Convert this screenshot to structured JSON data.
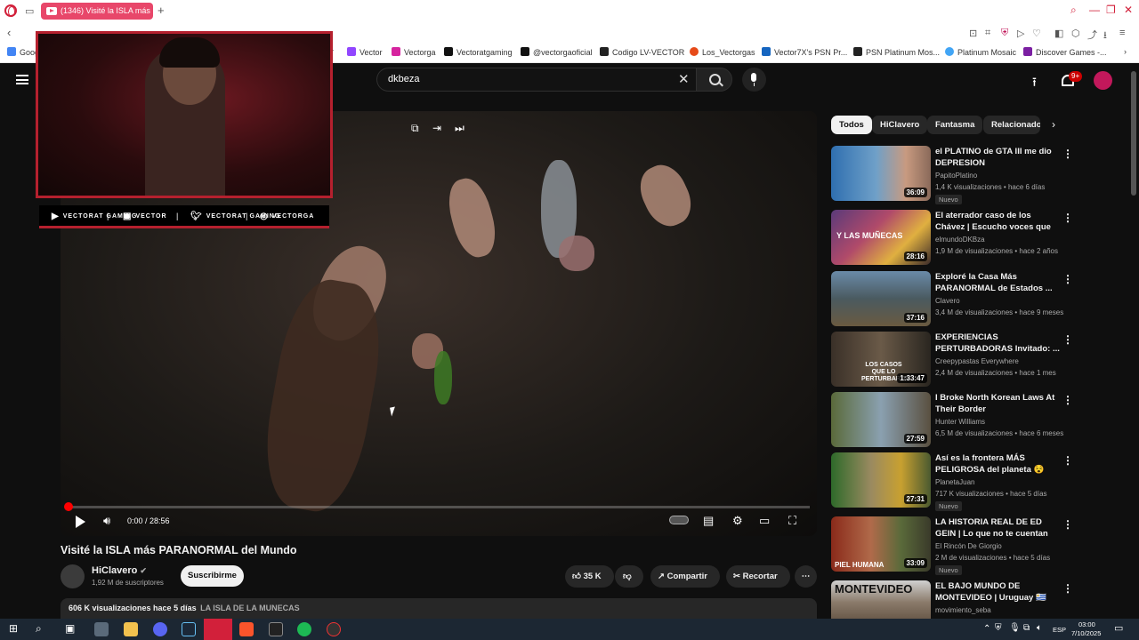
{
  "browser": {
    "tab_title": "(1346) Visité la ISLA más",
    "bookmarks": [
      {
        "label": "Google"
      },
      {
        "label": "r"
      },
      {
        "label": "Vector"
      },
      {
        "label": "Vectorga"
      },
      {
        "label": "Vectoratgaming"
      },
      {
        "label": "@vectorgaoficial"
      },
      {
        "label": "Codigo LV-VECTOR"
      },
      {
        "label": "Los_Vectorgas"
      },
      {
        "label": "Vector7X's PSN Pr..."
      },
      {
        "label": "PSN Platinum Mos..."
      },
      {
        "label": "Platinum Mosaic"
      },
      {
        "label": "Discover Games -..."
      }
    ]
  },
  "header": {
    "search_value": "dkbeza",
    "notif_count": "9+"
  },
  "player": {
    "time": "0:00 / 28:56",
    "progress": 0.0
  },
  "overlay": {
    "social": [
      "GAMING",
      "VECTOR",
      "GAMING",
      "VECTORGA"
    ],
    "social_prefix": [
      "VECTORAT",
      "",
      "VECTORAT",
      ""
    ]
  },
  "video": {
    "title": "Visité la ISLA más PARANORMAL del Mundo",
    "channel": "HiClavero",
    "subscribers": "1,92 M de suscriptores",
    "subscribe_label": "Suscribirme",
    "likes": "35 K",
    "share_label": "Compartir",
    "clip_label": "Recortar",
    "views_date": "606 K visualizaciones  hace 5 días",
    "tag": "LA ISLA DE LA MUNECAS"
  },
  "sidebar": {
    "chips": [
      "Todos",
      "HiClavero",
      "Fantasma",
      "Relacionado"
    ],
    "items": [
      {
        "title": "el PLATINO de GTA III me dio DEPRESION",
        "channel": "PapitoPlatino",
        "meta": "1,4 K visualizaciones • hace 6 días",
        "duration": "36:09",
        "badge": "Nuevo"
      },
      {
        "title": "El aterrador caso de los Chávez | Escucho voces que vienen de...",
        "channel": "elmundoDKBza",
        "meta": "1,9 M de visualizaciones • hace 2 años",
        "duration": "28:16",
        "badge": ""
      },
      {
        "title": "Exploré la Casa Más PARANORMAL de Estados ...",
        "channel": "Clavero",
        "meta": "3,4 M de visualizaciones • hace 9 meses",
        "duration": "37:16",
        "badge": ""
      },
      {
        "title": "EXPERIENCIAS PERTURBADORAS Invitado: ...",
        "channel": "Creepypastas Everywhere",
        "meta": "2,4 M de visualizaciones • hace 1 mes",
        "duration": "1:33:47",
        "badge": ""
      },
      {
        "title": "I Broke North Korean Laws At Their Border",
        "channel": "Hunter Williams",
        "meta": "6,5 M de visualizaciones • hace 6 meses",
        "duration": "27:59",
        "badge": ""
      },
      {
        "title": "Así es la frontera MÁS PELIGROSA del planeta 😵",
        "channel": "PlanetaJuan",
        "meta": "717 K visualizaciones • hace 5 días",
        "duration": "27:31",
        "badge": "Nuevo"
      },
      {
        "title": "LA HISTORIA REAL DE ED GEIN | Lo que no te cuentan del ...",
        "channel": "El Rincón De Giorgio",
        "meta": "2 M de visualizaciones • hace 5 días",
        "duration": "33:09",
        "badge": "Nuevo"
      },
      {
        "title": "EL BAJO MUNDO DE MONTEVIDEO | Uruguay 🇺🇾",
        "channel": "movimiento_seba",
        "meta": "",
        "duration": "",
        "badge": ""
      }
    ],
    "thumb_texts": [
      "",
      "Y LAS MUÑECAS",
      "",
      "LOS CASOS QUE LO PERTURBARON",
      "",
      "",
      "PIEL HUMANA",
      "MONTEVIDEO"
    ]
  },
  "taskbar": {
    "lang": "ESP",
    "time": "03:00",
    "date": "7/10/2025"
  }
}
